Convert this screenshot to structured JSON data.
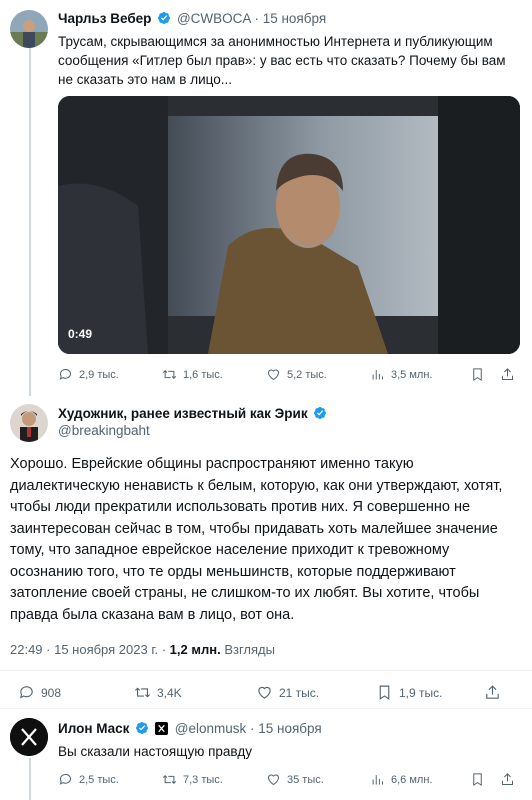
{
  "tweet1": {
    "name": "Чарльз Вебер",
    "handle": "@CWBOCA",
    "dot": "·",
    "date": "15 ноября",
    "text": "Трусам, скрывающимся за анонимностью Интернета и публикующим сообщения «Гитлер был прав»: у вас есть что сказать? Почему бы вам не сказать это нам в лицо...",
    "video_duration": "0:49",
    "replies": "2,9 тыс.",
    "reposts": "1,6 тыс.",
    "likes": "5,2 тыс.",
    "views": "3,5 млн."
  },
  "tweet2": {
    "name": "Художник, ранее известный как Эрик",
    "handle": "@breakingbaht",
    "text": "Хорошо. Еврейские общины распространяют именно такую диалектическую ненависть к белым, которую, как они утверждают, хотят, чтобы люди прекратили использовать против них. Я совершенно не заинтересован сейчас в том, чтобы придавать хоть малейшее значение тому, что западное еврейское население приходит к тревожному осознанию того, что те орды меньшинств, которые поддерживают затопление своей страны, не слишком-то их любят. Вы хотите, чтобы правда была сказана вам в лицо, вот она.",
    "timestamp": "22:49 · 15 ноября 2023 г. ·",
    "views_count": "1,2 млн.",
    "views_label": "Взгляды",
    "replies": "908",
    "reposts": "3,4K",
    "likes": "21 тыс.",
    "bookmarks": "1,9 тыс."
  },
  "tweet3": {
    "name": "Илон Маск",
    "handle": "@elonmusk",
    "dot": "·",
    "date": "15 ноября",
    "text": "Вы сказали настоящую правду",
    "replies": "2,5 тыс.",
    "reposts": "7,3 тыс.",
    "likes": "35 тыс.",
    "views": "6,6 млн."
  },
  "icons": {
    "verified": "verified-badge-icon",
    "reply": "reply-icon",
    "repost": "repost-icon",
    "like": "heart-icon",
    "views": "views-chart-icon",
    "bookmark": "bookmark-icon",
    "share": "share-icon"
  },
  "colors": {
    "verified_blue": "#1d9bf0",
    "text": "#0f1419",
    "secondary": "#536471"
  }
}
